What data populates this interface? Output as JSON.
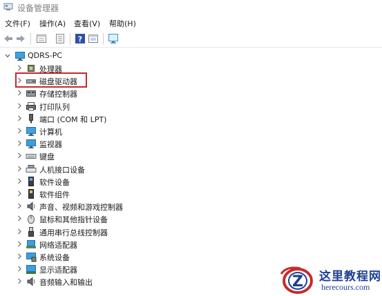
{
  "window": {
    "title": "设备管理器"
  },
  "menu": [
    "文件(F)",
    "操作(A)",
    "查看(V)",
    "帮助(H)"
  ],
  "tree": {
    "root": "QDRS-PC",
    "items": [
      {
        "label": "处理器",
        "icon": "processor-icon"
      },
      {
        "label": "磁盘驱动器",
        "icon": "disk-drive-icon"
      },
      {
        "label": "存储控制器",
        "icon": "storage-controller-icon"
      },
      {
        "label": "打印队列",
        "icon": "printer-icon"
      },
      {
        "label": "端口 (COM 和 LPT)",
        "icon": "port-icon"
      },
      {
        "label": "计算机",
        "icon": "computer-icon"
      },
      {
        "label": "监视器",
        "icon": "monitor-icon"
      },
      {
        "label": "键盘",
        "icon": "keyboard-icon"
      },
      {
        "label": "人机接口设备",
        "icon": "hid-icon"
      },
      {
        "label": "软件设备",
        "icon": "software-device-icon"
      },
      {
        "label": "软件组件",
        "icon": "software-component-icon"
      },
      {
        "label": "声音、视频和游戏控制器",
        "icon": "sound-icon"
      },
      {
        "label": "鼠标和其他指针设备",
        "icon": "mouse-icon"
      },
      {
        "label": "通用串行总线控制器",
        "icon": "usb-icon"
      },
      {
        "label": "网络适配器",
        "icon": "network-adapter-icon"
      },
      {
        "label": "系统设备",
        "icon": "system-device-icon"
      },
      {
        "label": "显示适配器",
        "icon": "display-adapter-icon"
      },
      {
        "label": "音频输入和输出",
        "icon": "audio-io-icon"
      }
    ]
  },
  "highlight_color": "#c0282c",
  "watermark": {
    "title": "这里教程网",
    "url": "herecours.com"
  }
}
